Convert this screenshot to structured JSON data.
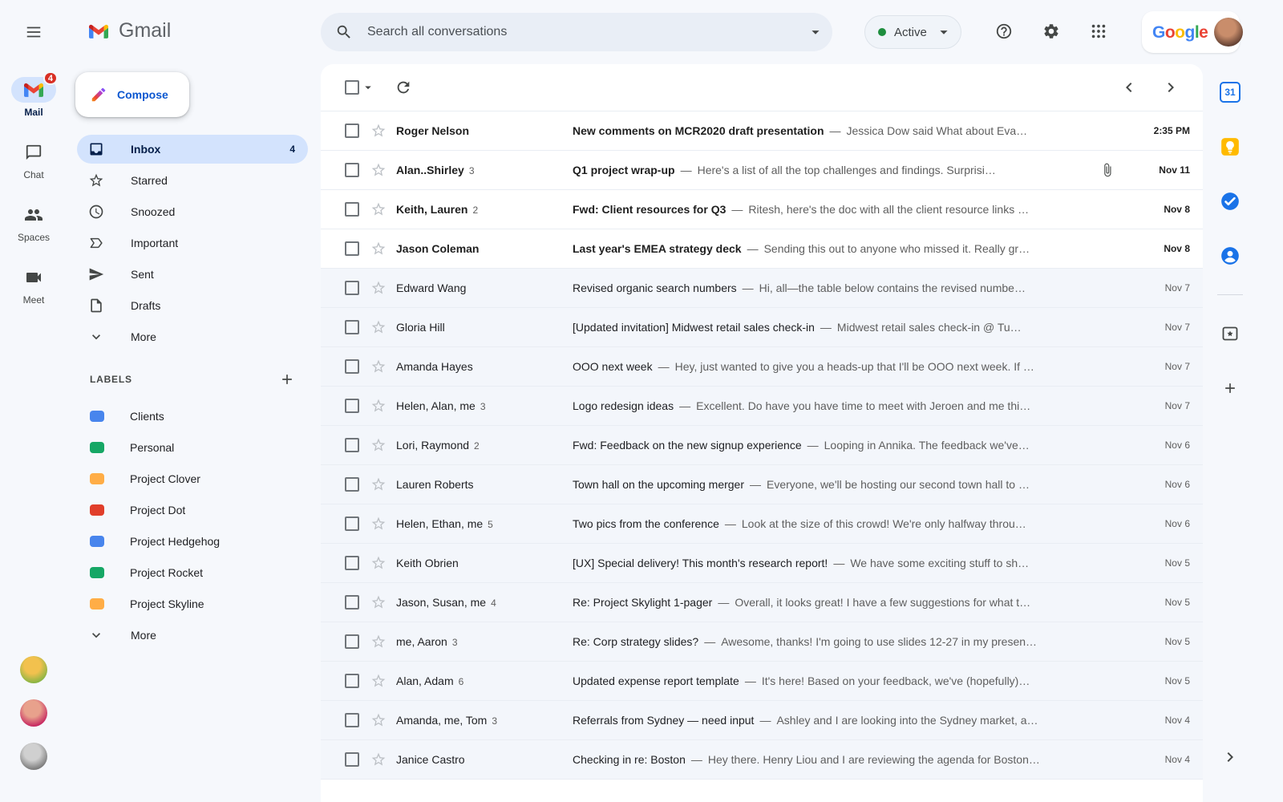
{
  "app": {
    "name": "Gmail"
  },
  "left_rail": {
    "items": [
      {
        "icon": "gmail-envelope-icon",
        "label": "Mail",
        "badge": "4",
        "active": true
      },
      {
        "icon": "chat-icon",
        "label": "Chat"
      },
      {
        "icon": "spaces-icon",
        "label": "Spaces"
      },
      {
        "icon": "meet-icon",
        "label": "Meet"
      }
    ],
    "avatars": [
      {
        "colors": [
          "#f2c14e",
          "#7cb342"
        ]
      },
      {
        "colors": [
          "#e8a18c",
          "#c2185b"
        ]
      },
      {
        "colors": [
          "#d0d0d0",
          "#707070"
        ]
      }
    ]
  },
  "sidebar": {
    "compose": "Compose",
    "nav": [
      {
        "icon": "inbox-icon",
        "label": "Inbox",
        "count": "4",
        "active": true
      },
      {
        "icon": "star-icon",
        "label": "Starred"
      },
      {
        "icon": "snooze-icon",
        "label": "Snoozed"
      },
      {
        "icon": "important-icon",
        "label": "Important"
      },
      {
        "icon": "sent-icon",
        "label": "Sent"
      },
      {
        "icon": "draft-icon",
        "label": "Drafts"
      },
      {
        "icon": "chevron-down-icon",
        "label": "More"
      }
    ],
    "labels_header": "LABELS",
    "labels": [
      {
        "name": "Clients",
        "color": "#4885ed"
      },
      {
        "name": "Personal",
        "color": "#16a765"
      },
      {
        "name": "Project Clover",
        "color": "#ffad46"
      },
      {
        "name": "Project Dot",
        "color": "#e13e2a"
      },
      {
        "name": "Project Hedgehog",
        "color": "#4885ed"
      },
      {
        "name": "Project Rocket",
        "color": "#16a765"
      },
      {
        "name": "Project Skyline",
        "color": "#ffad46"
      }
    ],
    "labels_more": "More"
  },
  "topbar": {
    "search_placeholder": "Search all conversations",
    "status": "Active",
    "status_color": "#1e8e3e",
    "google_letters": [
      {
        "ch": "G",
        "color": "#4285F4"
      },
      {
        "ch": "o",
        "color": "#EA4335"
      },
      {
        "ch": "o",
        "color": "#FBBC05"
      },
      {
        "ch": "g",
        "color": "#4285F4"
      },
      {
        "ch": "l",
        "color": "#34A853"
      },
      {
        "ch": "e",
        "color": "#EA4335"
      }
    ],
    "avatar_colors": [
      "#c98d6b",
      "#54352a"
    ]
  },
  "emails": {
    "separator": "—",
    "rows": [
      {
        "sender": "Roger Nelson",
        "subject": "New comments on MCR2020 draft presentation",
        "snippet": "Jessica Dow said What about Eva…",
        "date": "2:35 PM",
        "unread": true
      },
      {
        "sender": "Alan..Shirley",
        "count": "3",
        "subject": "Q1 project wrap-up",
        "snippet": "Here's a list of all the top challenges and findings. Surprisi…",
        "date": "Nov 11",
        "unread": true,
        "attachment": true
      },
      {
        "sender": "Keith, Lauren",
        "count": "2",
        "subject": "Fwd: Client resources for Q3",
        "snippet": "Ritesh, here's the doc with all the client resource links …",
        "date": "Nov 8",
        "unread": true
      },
      {
        "sender": "Jason Coleman",
        "subject": "Last year's EMEA strategy deck",
        "snippet": "Sending this out to anyone who missed it. Really gr…",
        "date": "Nov 8",
        "unread": true
      },
      {
        "sender": "Edward Wang",
        "subject": "Revised organic search numbers",
        "snippet": "Hi, all—the table below contains the revised numbe…",
        "date": "Nov 7"
      },
      {
        "sender": "Gloria Hill",
        "subject": "[Updated invitation] Midwest retail sales check-in",
        "snippet": "Midwest retail sales check-in @ Tu…",
        "date": "Nov 7"
      },
      {
        "sender": "Amanda Hayes",
        "subject": "OOO next week",
        "snippet": "Hey, just wanted to give you a heads-up that I'll be OOO next week. If …",
        "date": "Nov 7"
      },
      {
        "sender": "Helen, Alan, me",
        "count": "3",
        "subject": "Logo redesign ideas",
        "snippet": "Excellent. Do have you have time to meet with Jeroen and me thi…",
        "date": "Nov 7"
      },
      {
        "sender": "Lori, Raymond",
        "count": "2",
        "subject": "Fwd: Feedback on the new signup experience",
        "snippet": "Looping in Annika. The feedback we've…",
        "date": "Nov 6"
      },
      {
        "sender": "Lauren Roberts",
        "subject": "Town hall on the upcoming merger",
        "snippet": "Everyone, we'll be hosting our second town hall to …",
        "date": "Nov 6"
      },
      {
        "sender": "Helen, Ethan, me",
        "count": "5",
        "subject": "Two pics from the conference",
        "snippet": "Look at the size of this crowd! We're only halfway throu…",
        "date": "Nov 6"
      },
      {
        "sender": "Keith Obrien",
        "subject": "[UX] Special delivery! This month's research report!",
        "snippet": "We have some exciting stuff to sh…",
        "date": "Nov 5"
      },
      {
        "sender": "Jason, Susan, me",
        "count": "4",
        "subject": "Re: Project Skylight 1-pager",
        "snippet": "Overall, it looks great! I have a few suggestions for what t…",
        "date": "Nov 5"
      },
      {
        "sender": "me, Aaron",
        "count": "3",
        "subject": "Re: Corp strategy slides?",
        "snippet": "Awesome, thanks! I'm going to use slides 12-27 in my presen…",
        "date": "Nov 5"
      },
      {
        "sender": "Alan, Adam",
        "count": "6",
        "subject": "Updated expense report template",
        "snippet": "It's here! Based on your feedback, we've (hopefully)…",
        "date": "Nov 5"
      },
      {
        "sender": "Amanda, me, Tom",
        "count": "3",
        "subject": "Referrals from Sydney — need input",
        "snippet": "Ashley and I are looking into the Sydney market, a…",
        "date": "Nov 4"
      },
      {
        "sender": "Janice Castro",
        "subject": "Checking in re: Boston",
        "snippet": "Hey there. Henry Liou and I are reviewing the agenda for Boston…",
        "date": "Nov 4"
      }
    ]
  },
  "right_rail": {
    "items": [
      {
        "icon": "calendar-icon",
        "label": "31"
      },
      {
        "icon": "keep-icon"
      },
      {
        "icon": "tasks-icon"
      },
      {
        "icon": "contacts-icon"
      },
      {
        "divider": true
      },
      {
        "icon": "addon-icon"
      },
      {
        "icon": "plus-icon"
      }
    ]
  }
}
